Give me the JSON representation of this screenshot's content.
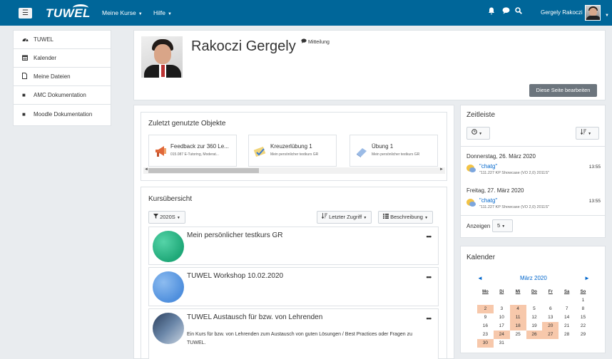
{
  "nav": {
    "menu_icon": "hamburger-icon",
    "logo": "TUWEL",
    "my_courses": "Meine Kurse",
    "help": "Hilfe",
    "icons": [
      "bell-icon",
      "chat-icon",
      "search-icon"
    ],
    "user_name": "Gergely Rakoczi"
  },
  "sidebar": {
    "items": [
      {
        "label": "TUWEL",
        "icon": "tachometer-icon"
      },
      {
        "label": "Kalender",
        "icon": "calendar-icon"
      },
      {
        "label": "Meine Dateien",
        "icon": "file-icon"
      },
      {
        "label": "AMC Dokumentation",
        "icon": "bullet-icon"
      },
      {
        "label": "Moodle Dokumentation",
        "icon": "bullet-icon"
      }
    ]
  },
  "profile": {
    "name": "Rakoczi Gergely",
    "message_label": "Mitteilung",
    "edit_button": "Diese Seite bearbeiten"
  },
  "recent": {
    "title": "Zuletzt genutzte Objekte",
    "items": [
      {
        "title": "Feedback zur 360 Le...",
        "subtitle": "015.087 E-Tutoring, Moderat...",
        "icon": "megaphone-icon"
      },
      {
        "title": "Kreuzerlübung 1",
        "subtitle": "Mein persönlicher testkurs GR",
        "icon": "checkmark-sheet-icon"
      },
      {
        "title": "Übung 1",
        "subtitle": "Mein persönlicher testkurs GR",
        "icon": "assignment-icon"
      }
    ]
  },
  "overview": {
    "title": "Kursübersicht",
    "filter": "2020S",
    "sort": "Letzter Zugriff",
    "view": "Beschreibung",
    "courses": [
      {
        "name": "Mein persönlicher testkurs GR",
        "description": "",
        "color": "#2fbf8f"
      },
      {
        "name": "TUWEL Workshop 10.02.2020",
        "description": "",
        "color": "#6fa8e8"
      },
      {
        "name": "TUWEL Austausch für bzw. von Lehrenden",
        "description": "Ein Kurs für bzw. von Lehrenden zum Austausch von guten Lösungen / Best Practices oder Fragen zu TUWEL.",
        "color": "#3f5a7a"
      }
    ]
  },
  "timeline": {
    "title": "Zeitleiste",
    "days": [
      {
        "date": "Donnerstag, 26. März 2020",
        "event": "\"chatg\"",
        "sub": "\"111.227 KP Showcase (VO 2,0) 2011S\"",
        "time": "13:55"
      },
      {
        "date": "Freitag, 27. März 2020",
        "event": "\"chatg\"",
        "sub": "\"111.227 KP Showcase (VO 2,0) 2011S\"",
        "time": "13:55"
      }
    ],
    "show_label": "Anzeigen",
    "show_value": "5"
  },
  "calendar": {
    "title": "Kalender",
    "month": "März 2020",
    "prev": "◄",
    "next": "►",
    "headers": [
      "Mo",
      "Di",
      "Mi",
      "Do",
      "Fr",
      "Sa",
      "So"
    ],
    "weeks": [
      [
        "",
        "",
        "",
        "",
        "",
        "",
        "1"
      ],
      [
        "2",
        "3",
        "4",
        "5",
        "6",
        "7",
        "8"
      ],
      [
        "9",
        "10",
        "11",
        "12",
        "13",
        "14",
        "15"
      ],
      [
        "16",
        "17",
        "18",
        "19",
        "20",
        "21",
        "22"
      ],
      [
        "23",
        "24",
        "25",
        "26",
        "27",
        "28",
        "29"
      ],
      [
        "30",
        "31",
        "",
        "",
        "",
        "",
        ""
      ]
    ],
    "event_days": [
      "2",
      "4",
      "11",
      "18",
      "20",
      "24",
      "26",
      "27",
      "30"
    ],
    "event_color": "#f7c8ab"
  }
}
